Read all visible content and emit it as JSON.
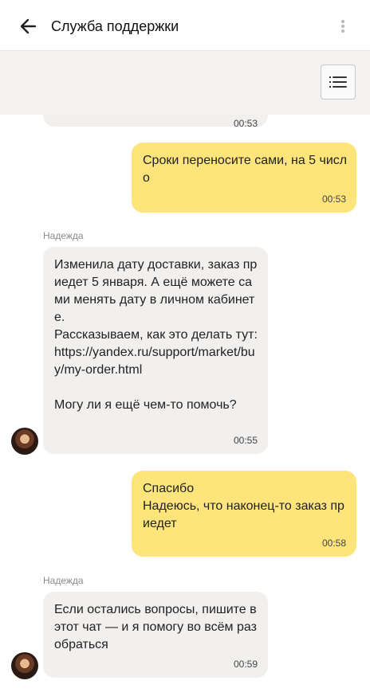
{
  "header": {
    "title": "Служба поддержки"
  },
  "messages": [
    {
      "time_partial": "00:53"
    },
    {
      "text": "Сроки переносите сами, на 5 число",
      "time": "00:53"
    },
    {
      "sender": "Надежда",
      "text": "Изменила дату доставки, заказ приедет 5 января. А ещё можете сами менять дату в личном кабинете.\nРассказываем, как это делать тут:\nhttps://yandex.ru/support/market/buy/my-order.html\n\nМогу ли я ещё чем-то помочь?",
      "time": "00:55"
    },
    {
      "text": "Спасибо\nНадеюсь, что наконец-то заказ приедет",
      "time": "00:58"
    },
    {
      "sender": "Надежда",
      "text": "Если остались вопросы, пишите в этот чат — и я помогу во всём разобраться",
      "time": "00:59"
    }
  ],
  "icons": {
    "back": "arrow-left-icon",
    "more": "more-vertical-icon",
    "menu": "list-menu-icon",
    "avatar": "agent-avatar"
  },
  "colors": {
    "incoming_bubble": "#f1f0ef",
    "outgoing_bubble": "#fde47b",
    "toolbar_bg": "#f4f3f1"
  }
}
